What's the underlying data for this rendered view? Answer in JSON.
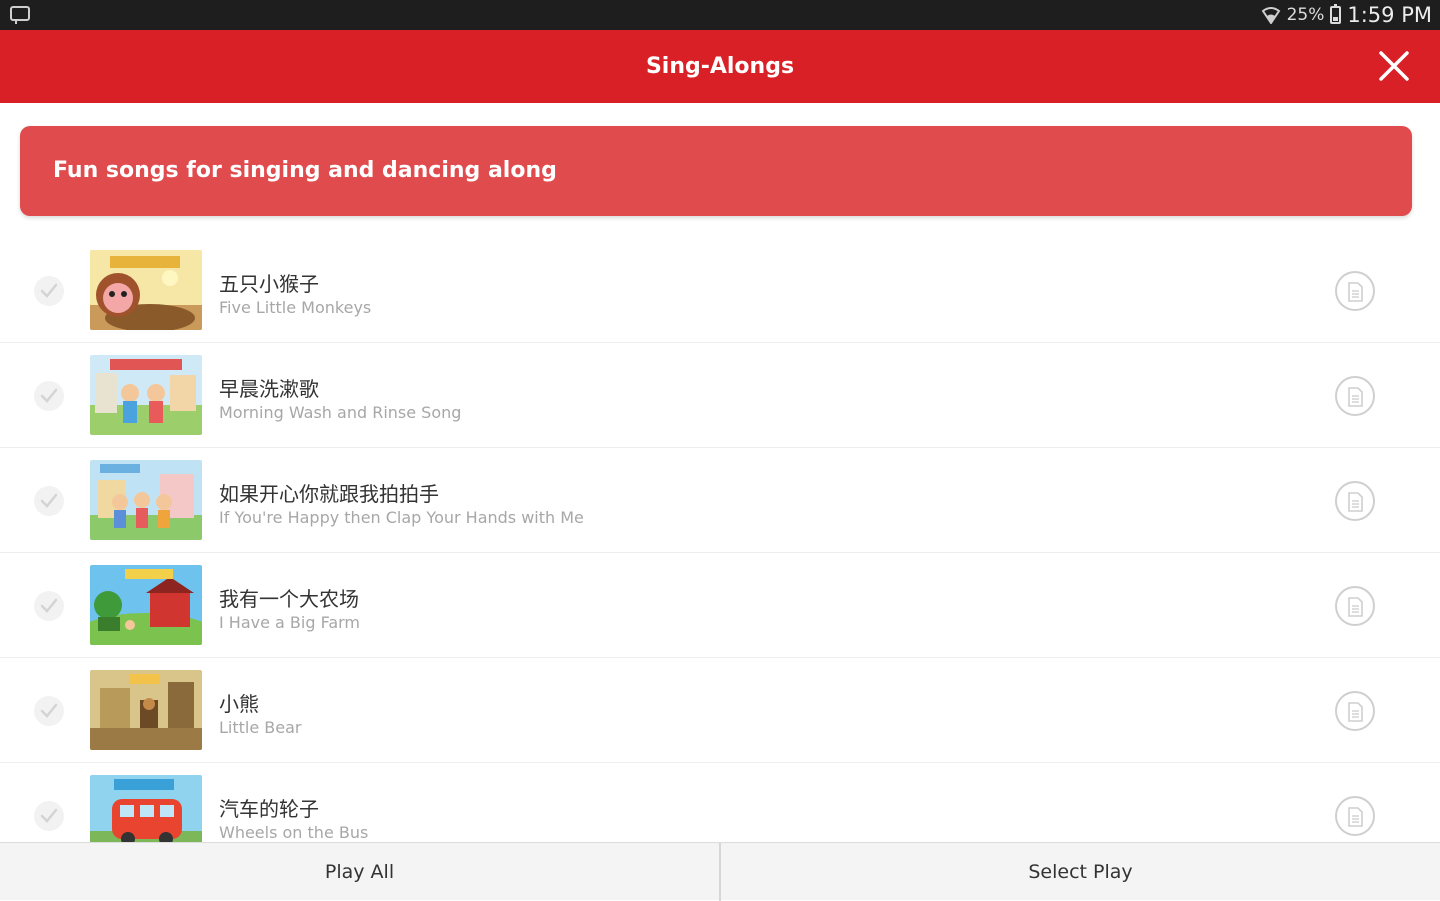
{
  "status_bar": {
    "battery_percent": "25%",
    "time": "1:59 PM"
  },
  "header": {
    "title": "Sing-Alongs",
    "close_icon": "close-icon"
  },
  "banner": {
    "text": "Fun songs for singing and dancing along"
  },
  "songs": [
    {
      "title_cn": "五只小猴子",
      "title_en": "Five Little Monkeys"
    },
    {
      "title_cn": "早晨洗漱歌",
      "title_en": "Morning Wash and Rinse Song"
    },
    {
      "title_cn": "如果开心你就跟我拍拍手",
      "title_en": "If You're Happy then Clap Your Hands with Me"
    },
    {
      "title_cn": "我有一个大农场",
      "title_en": "I Have a Big Farm"
    },
    {
      "title_cn": "小熊",
      "title_en": "Little Bear"
    },
    {
      "title_cn": "汽车的轮子",
      "title_en": "Wheels on the Bus"
    }
  ],
  "bottom": {
    "play_all": "Play All",
    "select_play": "Select Play"
  },
  "colors": {
    "header_red": "#d92026",
    "banner_red": "#e04b4e"
  }
}
